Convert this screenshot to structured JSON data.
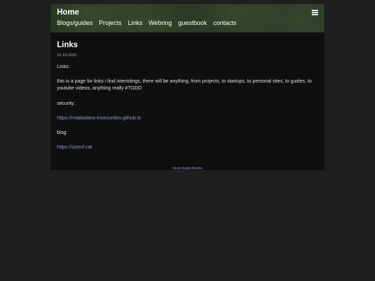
{
  "header": {
    "home_label": "Home",
    "menu_icon": "hamburger-menu-icon",
    "nav": [
      {
        "label": "Blogs/guides"
      },
      {
        "label": "Projects"
      },
      {
        "label": "Links"
      },
      {
        "label": "Webring"
      },
      {
        "label": "guestbook"
      },
      {
        "label": "contacts"
      }
    ]
  },
  "post": {
    "title": "Links",
    "date": "15-10-2025",
    "intro_label": "Links:",
    "description": "this is a page for links i find interistings, there will be anything, from projects, to startups, to personal sites, to guides, to youtube videos, anything really #TODO",
    "sections": [
      {
        "heading": "security:",
        "link": "https://madaidans-insecurities.github.io"
      },
      {
        "heading": "blog:",
        "link": "https://sizeof.cat"
      }
    ]
  },
  "footer": {
    "theme_link": "no-js-hugo-theme"
  },
  "colors": {
    "page_background": "#1f1f1f",
    "content_background": "#0f0f0f",
    "link_color": "#8f9bd6",
    "text_color": "#e0e0e0"
  }
}
